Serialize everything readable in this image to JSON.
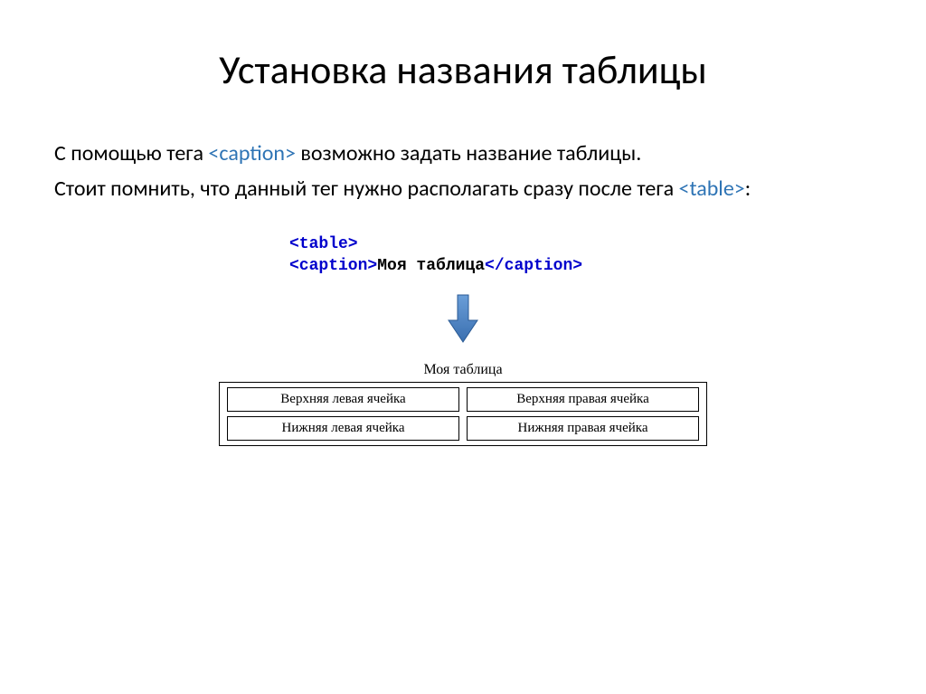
{
  "title": "Установка названия таблицы",
  "para1_a": "С помощью тега ",
  "para1_tag": "<caption>",
  "para1_b": "  возможно задать название таблицы.",
  "para2_a": "Стоит помнить, что данный тег нужно располагать сразу после тега ",
  "para2_tag": "<table>",
  "para2_b": ":",
  "code": {
    "line1": "<table>",
    "line2_open": "<caption>",
    "line2_text": "Моя таблица",
    "line2_close": "</caption>"
  },
  "example": {
    "caption": "Моя таблица",
    "cells": {
      "r0c0": "Верхняя левая ячейка",
      "r0c1": "Верхняя правая ячейка",
      "r1c0": "Нижняя левая ячейка",
      "r1c1": "Нижняя правая ячейка"
    }
  }
}
